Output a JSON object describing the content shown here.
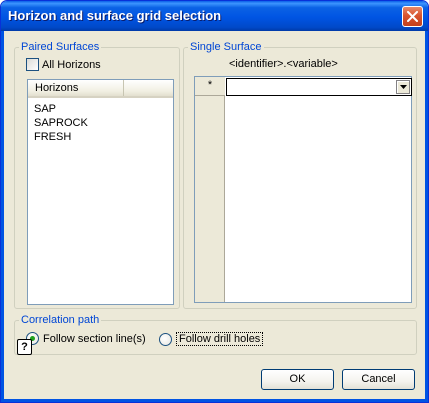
{
  "window": {
    "title": "Horizon and surface grid selection",
    "close_icon": "close-icon"
  },
  "paired_surfaces": {
    "legend": "Paired Surfaces",
    "all_horizons_label": "All Horizons",
    "all_horizons_checked": false,
    "column_header": "Horizons",
    "items": [
      "SAP",
      "SAPROCK",
      "FRESH"
    ]
  },
  "single_surface": {
    "legend": "Single Surface",
    "hint": "<identifier>.<variable>",
    "row_marker": "*",
    "combo_value": "",
    "combo_icon": "chevron-down-icon"
  },
  "correlation_path": {
    "legend": "Correlation path",
    "options": [
      {
        "label": "Follow section line(s)",
        "selected": true
      },
      {
        "label": "Follow drill holes",
        "selected": false
      }
    ]
  },
  "footer": {
    "help_icon": "help-icon",
    "help_glyph": "?",
    "ok_label": "OK",
    "cancel_label": "Cancel"
  },
  "colors": {
    "title_bar": "#0054e3",
    "group_legend": "#0046d5",
    "dialog_bg": "#ece9d8",
    "close_button": "#d9542f"
  }
}
